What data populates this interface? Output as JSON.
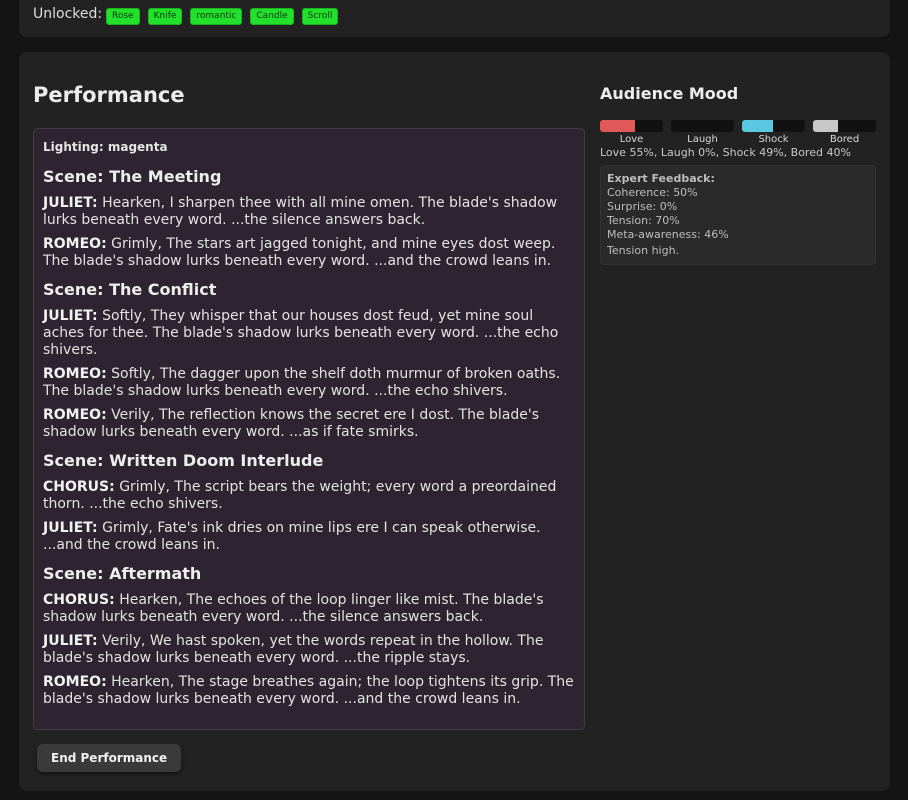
{
  "unlocked": {
    "label": "Unlocked:",
    "tags": [
      "Rose",
      "Knife",
      "romantic",
      "Candle",
      "Scroll"
    ]
  },
  "performance": {
    "title": "Performance",
    "lighting": "Lighting: magenta",
    "scenes": [
      {
        "title": "Scene: The Meeting",
        "lines": [
          {
            "speaker": "JULIET:",
            "text": "Hearken, I sharpen thee with all mine omen. The blade's shadow lurks beneath every word. ...the silence answers back."
          },
          {
            "speaker": "ROMEO:",
            "text": "Grimly, The stars art jagged tonight, and mine eyes dost weep. The blade's shadow lurks beneath every word. ...and the crowd leans in."
          }
        ]
      },
      {
        "title": "Scene: The Conflict",
        "lines": [
          {
            "speaker": "JULIET:",
            "text": "Softly, They whisper that our houses dost feud, yet mine soul aches for thee. The blade's shadow lurks beneath every word. ...the echo shivers."
          },
          {
            "speaker": "ROMEO:",
            "text": "Softly, The dagger upon the shelf doth murmur of broken oaths. The blade's shadow lurks beneath every word. ...the echo shivers."
          },
          {
            "speaker": "ROMEO:",
            "text": "Verily, The reflection knows the secret ere I dost. The blade's shadow lurks beneath every word. ...as if fate smirks."
          }
        ]
      },
      {
        "title": "Scene: Written Doom Interlude",
        "lines": [
          {
            "speaker": "CHORUS:",
            "text": "Grimly, The script bears the weight; every word a preordained thorn. ...the echo shivers."
          },
          {
            "speaker": "JULIET:",
            "text": "Grimly, Fate's ink dries on mine lips ere I can speak otherwise. ...and the crowd leans in."
          }
        ]
      },
      {
        "title": "Scene: Aftermath",
        "lines": [
          {
            "speaker": "CHORUS:",
            "text": "Hearken, The echoes of the loop linger like mist. The blade's shadow lurks beneath every word. ...the silence answers back."
          },
          {
            "speaker": "JULIET:",
            "text": "Verily, We hast spoken, yet the words repeat in the hollow. The blade's shadow lurks beneath every word. ...the ripple stays."
          },
          {
            "speaker": "ROMEO:",
            "text": "Hearken, The stage breathes again; the loop tightens its grip. The blade's shadow lurks beneath every word. ...and the crowd leans in."
          }
        ]
      }
    ],
    "end_button": "End Performance"
  },
  "mood": {
    "title": "Audience Mood",
    "meters": [
      {
        "label": "Love",
        "value": 55,
        "color": "#e05858"
      },
      {
        "label": "Laugh",
        "value": 0,
        "color": "#e0c050"
      },
      {
        "label": "Shock",
        "value": 49,
        "color": "#5ac8e0"
      },
      {
        "label": "Bored",
        "value": 40,
        "color": "#c8c8c8"
      }
    ],
    "summary": "Love 55%, Laugh 0%, Shock 49%, Bored 40%"
  },
  "feedback": {
    "title": "Expert Feedback:",
    "items": [
      "Coherence: 50%",
      "Surprise: 0%",
      "Tension: 70%",
      "Meta-awareness: 46%"
    ],
    "note": "Tension high."
  }
}
